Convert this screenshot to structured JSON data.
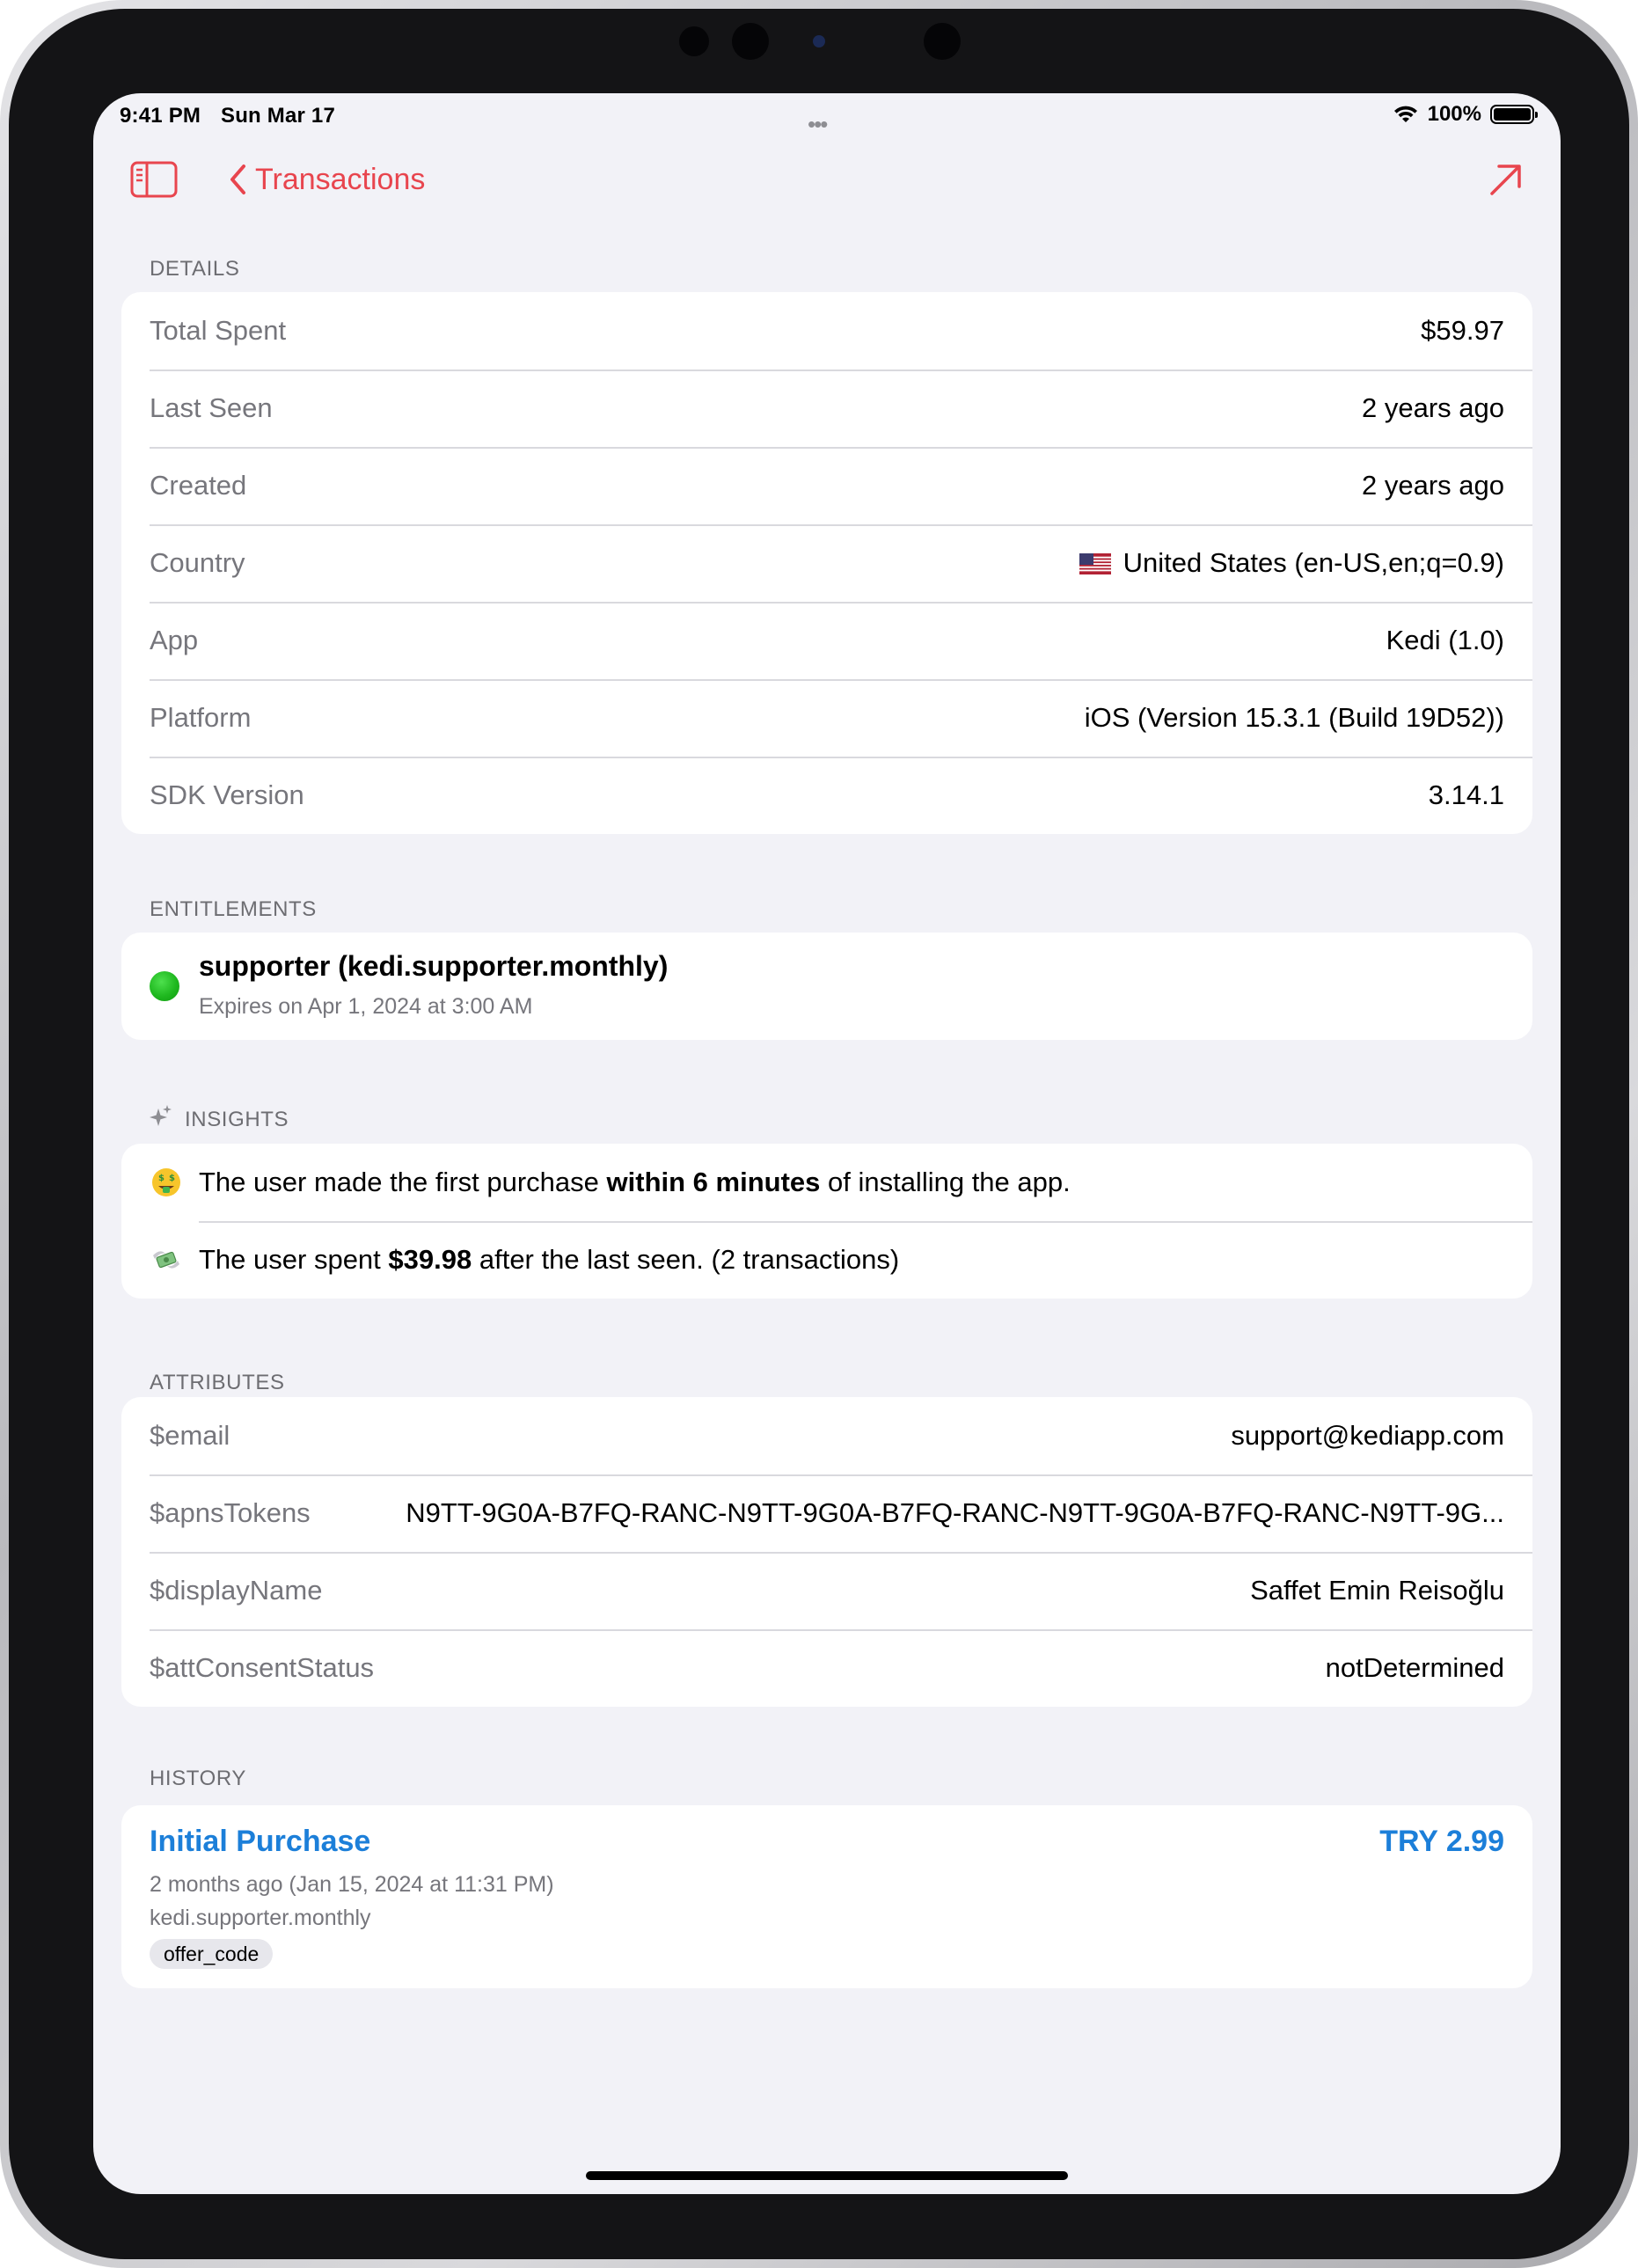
{
  "status_bar": {
    "time": "9:41 PM",
    "date": "Sun Mar 17",
    "battery": "100%",
    "battery_level": 1.0
  },
  "nav": {
    "back_label": "Transactions"
  },
  "details": {
    "header": "DETAILS",
    "rows": [
      {
        "label": "Total Spent",
        "value": "$59.97"
      },
      {
        "label": "Last Seen",
        "value": "2 years ago"
      },
      {
        "label": "Created",
        "value": "2 years ago"
      },
      {
        "label": "Country",
        "value": "United States (en-US,en;q=0.9)"
      },
      {
        "label": "App",
        "value": "Kedi (1.0)"
      },
      {
        "label": "Platform",
        "value": "iOS (Version 15.3.1 (Build 19D52))"
      },
      {
        "label": "SDK Version",
        "value": "3.14.1"
      }
    ]
  },
  "entitlements": {
    "header": "ENTITLEMENTS",
    "items": [
      {
        "title": "supporter (kedi.supporter.monthly)",
        "subtitle": "Expires on Apr 1, 2024 at 3:00 AM",
        "status_color": "#1fb81f"
      }
    ]
  },
  "insights": {
    "header": "INSIGHTS",
    "items": [
      {
        "icon": "money-mouth-face-icon",
        "pre": "The user made the first purchase ",
        "bold": "within 6 minutes",
        "post": " of installing the app."
      },
      {
        "icon": "money-with-wings-icon",
        "pre": "The user spent ",
        "bold": "$39.98",
        "post": " after the last seen. (2 transactions)"
      }
    ]
  },
  "attributes": {
    "header": "ATTRIBUTES",
    "rows": [
      {
        "label": "$email",
        "value": "support@kediapp.com"
      },
      {
        "label": "$apnsTokens",
        "value": "N9TT-9G0A-B7FQ-RANC-N9TT-9G0A-B7FQ-RANC-N9TT-9G0A-B7FQ-RANC-N9TT-9G..."
      },
      {
        "label": "$displayName",
        "value": "Saffet Emin Reisoğlu"
      },
      {
        "label": "$attConsentStatus",
        "value": "notDetermined"
      }
    ]
  },
  "history": {
    "header": "HISTORY",
    "items": [
      {
        "title": "Initial Purchase",
        "price": "TRY 2.99",
        "date": "2 months ago (Jan 15, 2024 at 11:31 PM)",
        "product": "kedi.supporter.monthly",
        "tag": "offer_code"
      }
    ]
  },
  "colors": {
    "accent": "#e8454e",
    "link": "#1c7fd9",
    "background": "#f2f2f7"
  }
}
